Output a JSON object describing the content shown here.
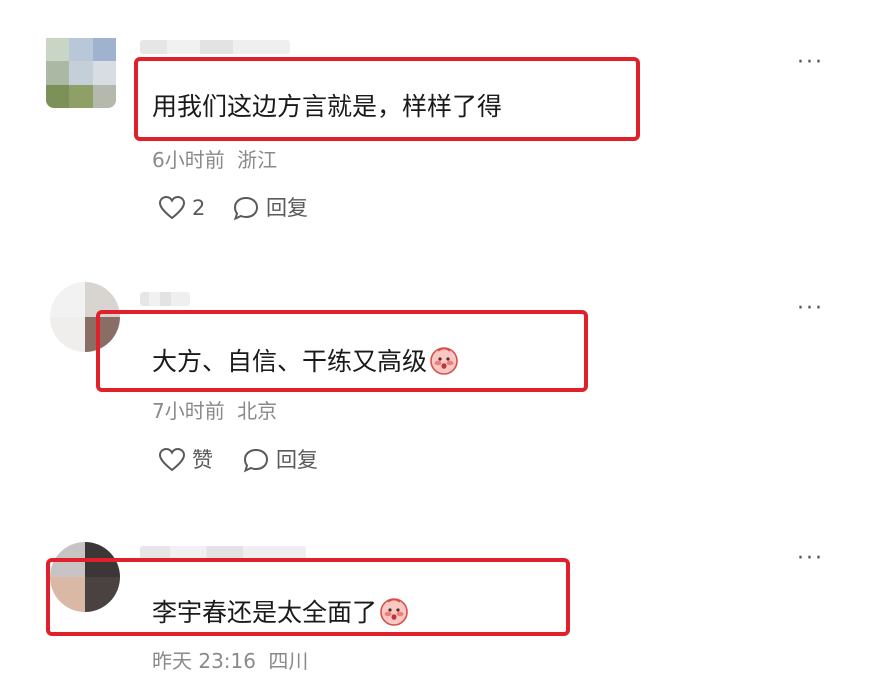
{
  "colors": {
    "highlight": "#e0202a",
    "meta": "#8a8a8a",
    "text": "#1a1a1a"
  },
  "comments": [
    {
      "text": "用我们这边方言就是，样样了得",
      "time": "6小时前",
      "location": "浙江",
      "like_label": "2",
      "reply_label": "回复",
      "more_label": "···"
    },
    {
      "text": "大方、自信、干练又高级",
      "emoji": "blushing-face-emoji",
      "time": "7小时前",
      "location": "北京",
      "like_label": "赞",
      "reply_label": "回复",
      "more_label": "···"
    },
    {
      "text": "李宇春还是太全面了",
      "emoji": "blushing-face-emoji",
      "time": "昨天 23:16",
      "location": "四川",
      "more_label": "···"
    }
  ]
}
